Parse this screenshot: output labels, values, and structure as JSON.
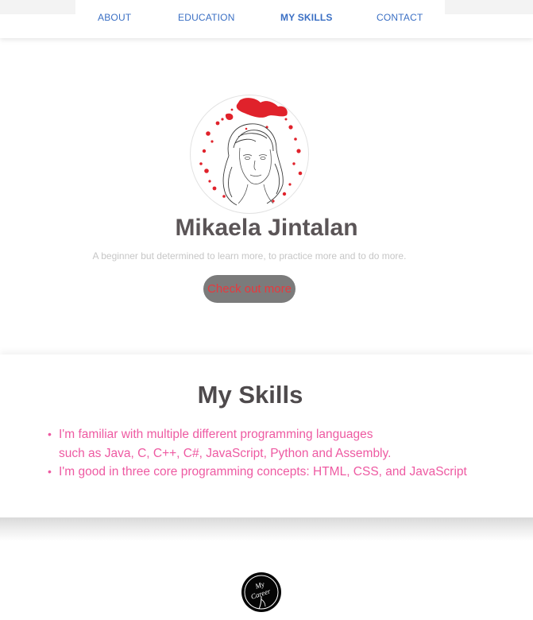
{
  "nav": {
    "items": [
      {
        "label": "ABOUT",
        "active": false
      },
      {
        "label": "EDUCATION",
        "active": false
      },
      {
        "label": "MY SKILLS",
        "active": true
      },
      {
        "label": "CONTACT",
        "active": false
      }
    ]
  },
  "hero": {
    "avatar_icon": "portrait-sketch-icon",
    "name": "Mikaela Jintalan",
    "tagline": "A beginner but determined to learn more, to practice more and to do more.",
    "cta_label": "Check out more"
  },
  "skills": {
    "title": "My Skills",
    "items": [
      {
        "lines": [
          "I'm familiar with multiple different programming languages",
          "such as Java, C, C++, C#, JavaScript, Python and Assembly."
        ]
      },
      {
        "lines": [
          "I'm good in three core programming concepts: HTML, CSS, and JavaScript"
        ]
      }
    ]
  },
  "footer": {
    "logo_icon": "my-career-logo-icon",
    "logo_text": "My Career"
  },
  "colors": {
    "nav_link": "#3a6fc4",
    "name": "#5b5557",
    "tagline": "#c6c6c6",
    "cta_bg": "#7b7b7b",
    "cta_text": "#e8383d",
    "skills_text": "#ee5aa2",
    "title": "#4e4a4c"
  }
}
